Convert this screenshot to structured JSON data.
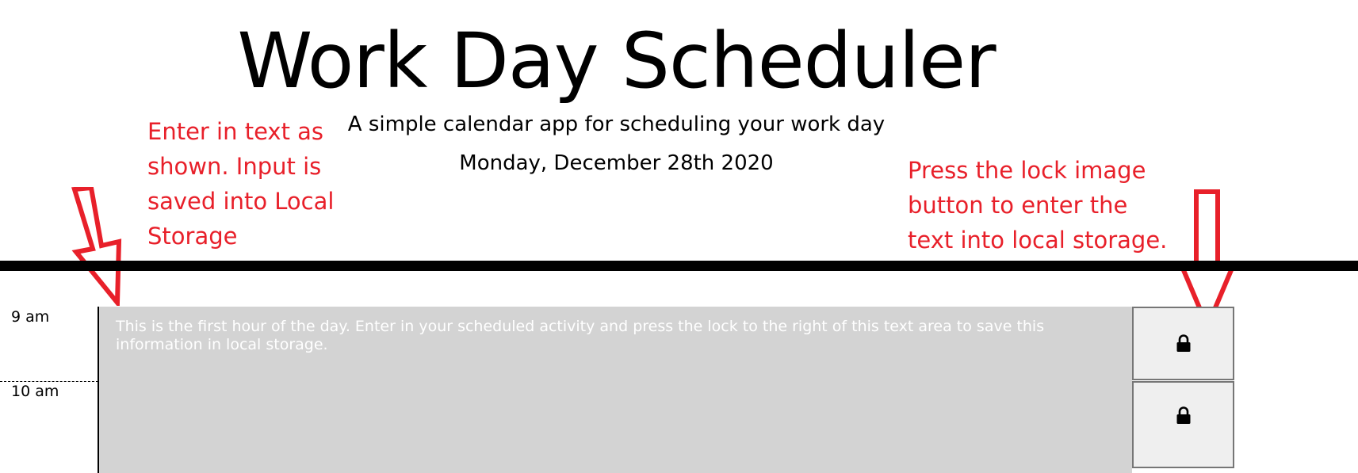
{
  "header": {
    "title": "Work Day Scheduler",
    "subtitle": "A simple calendar app for scheduling your work day",
    "date": "Monday, December 28th 2020"
  },
  "annotations": {
    "left_note": "Enter in text as\nshown. Input is\nsaved into Local\nStorage",
    "right_note": "Press the lock image\nbutton to enter the\ntext into local storage."
  },
  "schedule": {
    "rows": [
      {
        "hour": "9 am",
        "text": "This is the first hour of the day. Enter in your scheduled activity and press the lock to the right of this text area to save this information in local storage.",
        "button_icon": "lock-icon"
      },
      {
        "hour": "10 am",
        "text": "",
        "button_icon": "lock-icon"
      }
    ]
  },
  "colors": {
    "annotation": "#e8202a",
    "past_hour_background": "#d3d3d3",
    "button_background": "#efefef"
  }
}
